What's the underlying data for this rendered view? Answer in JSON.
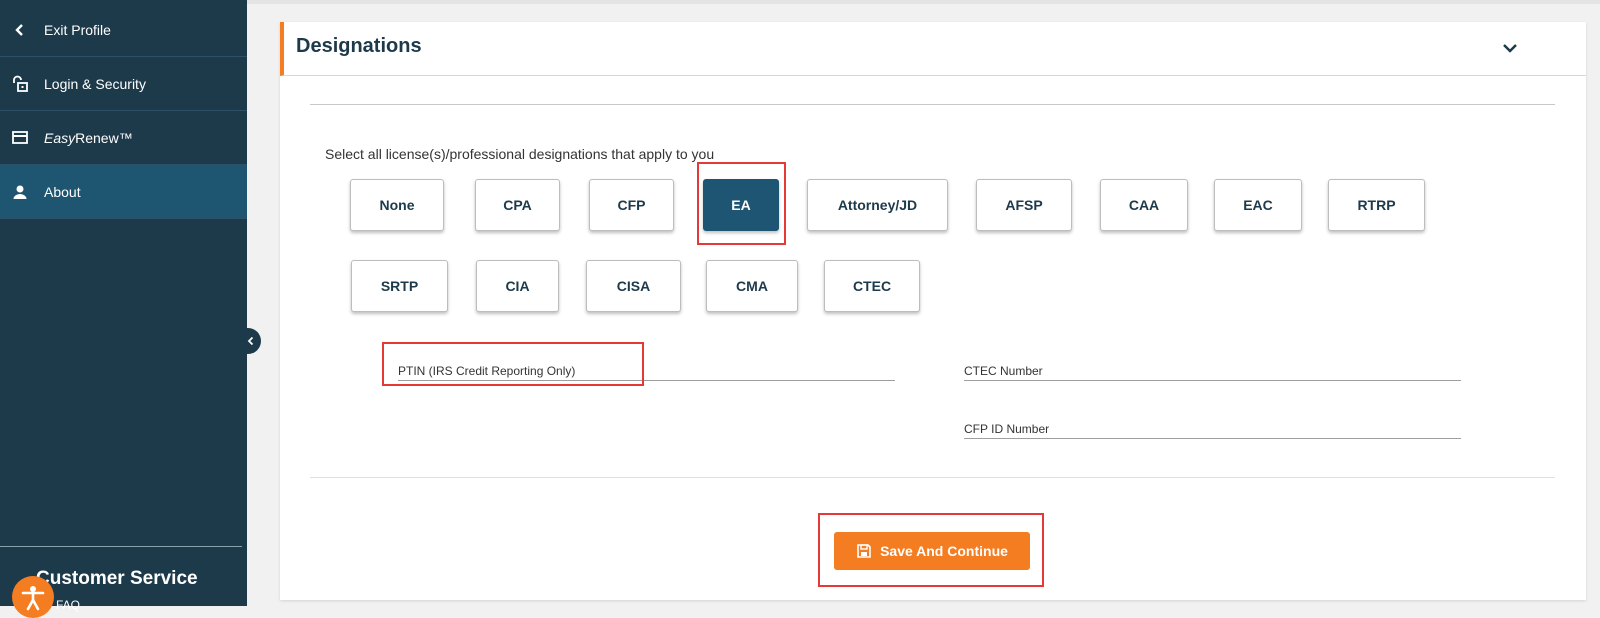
{
  "sidebar": {
    "items": [
      {
        "label": "Exit Profile",
        "icon": "chevron-left-icon"
      },
      {
        "label": "Login & Security",
        "icon": "unlock-icon"
      },
      {
        "label_italic": "Easy",
        "label_rest": "Renew™",
        "icon": "credit-card-icon"
      },
      {
        "label": "About",
        "icon": "user-icon",
        "active": true
      }
    ],
    "customer_service_title": "Customer Service",
    "customer_service_sub": "FAQ"
  },
  "card": {
    "title": "Designations",
    "instruction": "Select all license(s)/professional designations that apply to you",
    "designations_row1": [
      "None",
      "CPA",
      "CFP",
      "EA",
      "Attorney/JD",
      "AFSP",
      "CAA",
      "EAC",
      "RTRP"
    ],
    "designations_row2": [
      "SRTP",
      "CIA",
      "CISA",
      "CMA",
      "CTEC"
    ],
    "selected": "EA",
    "fields": {
      "ptin_label": "PTIN (IRS Credit Reporting Only)",
      "ctec_label": "CTEC Number",
      "cfp_label": "CFP ID Number"
    },
    "save_label": "Save And Continue"
  },
  "colors": {
    "sidebar_bg": "#1d3a4b",
    "active_bg": "#1e5570",
    "accent": "#f47d22",
    "selected_chip": "#1d5572",
    "highlight": "#e53935"
  }
}
